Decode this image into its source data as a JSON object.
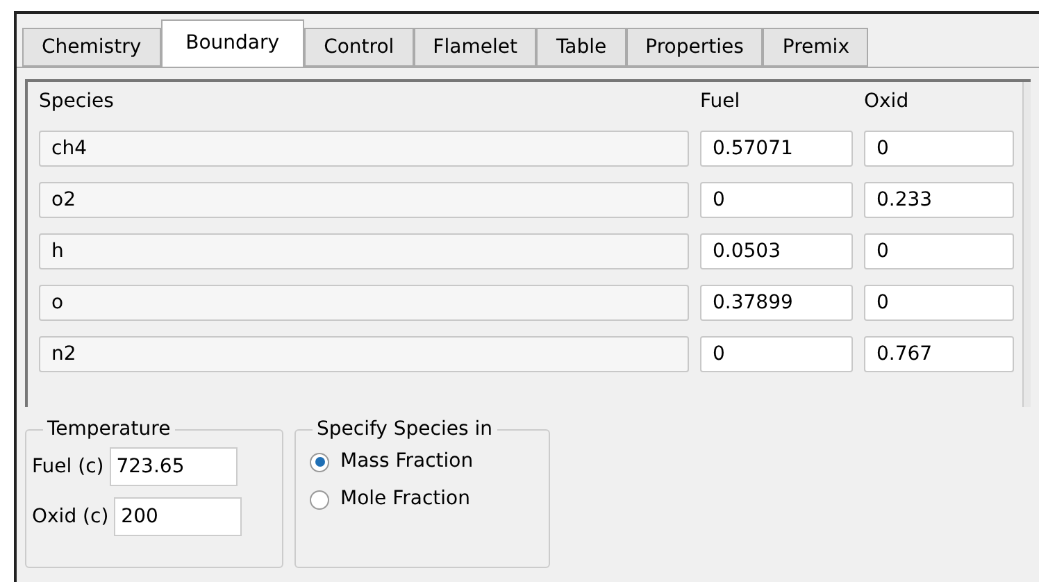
{
  "tabs": [
    {
      "label": "Chemistry",
      "selected": false
    },
    {
      "label": "Boundary",
      "selected": true
    },
    {
      "label": "Control",
      "selected": false
    },
    {
      "label": "Flamelet",
      "selected": false
    },
    {
      "label": "Table",
      "selected": false
    },
    {
      "label": "Properties",
      "selected": false
    },
    {
      "label": "Premix",
      "selected": false
    }
  ],
  "table": {
    "columns": [
      "Species",
      "Fuel",
      "Oxid"
    ],
    "rows": [
      {
        "species": "ch4",
        "fuel": "0.57071",
        "oxid": "0"
      },
      {
        "species": "o2",
        "fuel": "0",
        "oxid": "0.233"
      },
      {
        "species": "h",
        "fuel": "0.0503",
        "oxid": "0"
      },
      {
        "species": "o",
        "fuel": "0.37899",
        "oxid": "0"
      },
      {
        "species": "n2",
        "fuel": "0",
        "oxid": "0.767"
      }
    ]
  },
  "temperature": {
    "title": "Temperature",
    "fields": [
      {
        "label": "Fuel (c)",
        "value": "723.65"
      },
      {
        "label": "Oxid (c)",
        "value": "200"
      }
    ]
  },
  "specify": {
    "title": "Specify Species in",
    "options": [
      {
        "label": "Mass Fraction",
        "selected": true
      },
      {
        "label": "Mole Fraction",
        "selected": false
      }
    ]
  }
}
